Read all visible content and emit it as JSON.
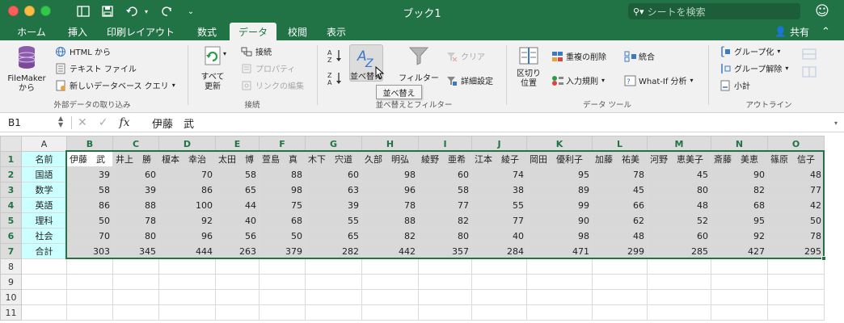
{
  "window": {
    "title": "ブック1",
    "search_placeholder": "シートを検索"
  },
  "tabs": [
    {
      "label": "ホーム"
    },
    {
      "label": "挿入"
    },
    {
      "label": "印刷レイアウト"
    },
    {
      "label": "数式"
    },
    {
      "label": "データ"
    },
    {
      "label": "校閲"
    },
    {
      "label": "表示"
    }
  ],
  "share_label": "共有",
  "ribbon": {
    "filemaker": "FileMaker\nから",
    "html_from": "HTML から",
    "text_file": "テキスト ファイル",
    "new_db_query": "新しいデータベース クエリ",
    "group_external": "外部データの取り込み",
    "refresh_all": "すべて\n更新",
    "connections": "接続",
    "properties": "プロパティ",
    "edit_links": "リンクの編集",
    "group_connections": "接続",
    "sort": "並べ替え",
    "filter": "フィルター",
    "clear": "クリア",
    "advanced": "詳細設定",
    "group_sort_filter": "並べ替えとフィルター",
    "text_to_columns": "区切り\n位置",
    "remove_duplicates": "重複の削除",
    "data_validation": "入力規則",
    "consolidate": "統合",
    "what_if": "What-If 分析",
    "group_data_tools": "データ ツール",
    "group": "グループ化",
    "ungroup": "グループ解除",
    "subtotal": "小計",
    "group_outline": "アウトライン",
    "tooltip": "並べ替え"
  },
  "formula_bar": {
    "name_box": "B1",
    "fx": "fx",
    "content": "伊藤　武"
  },
  "sheet": {
    "columns": [
      "A",
      "B",
      "C",
      "D",
      "E",
      "F",
      "G",
      "H",
      "I",
      "J",
      "K",
      "L",
      "M",
      "N",
      "O"
    ],
    "row_numbers": [
      "1",
      "2",
      "3",
      "4",
      "5",
      "6",
      "7",
      "8",
      "9",
      "10",
      "11"
    ],
    "header_row": [
      "名前",
      "伊藤　武",
      "井上　勝",
      "榎本　幸治",
      "太田　博",
      "萱島　真",
      "木下　宍道",
      "久部　明弘",
      "綾野　亜希",
      "江本　綾子",
      "岡田　優利子",
      "加藤　祐美",
      "河野　恵美子",
      "斎藤　美恵",
      "篠原　信子"
    ],
    "data_rows": [
      {
        "label": "国語",
        "values": [
          39,
          60,
          70,
          58,
          88,
          60,
          98,
          60,
          74,
          95,
          78,
          45,
          90,
          48
        ]
      },
      {
        "label": "数学",
        "values": [
          58,
          39,
          86,
          65,
          98,
          63,
          96,
          58,
          38,
          89,
          45,
          80,
          82,
          77
        ]
      },
      {
        "label": "英語",
        "values": [
          86,
          88,
          100,
          44,
          75,
          39,
          78,
          77,
          55,
          99,
          66,
          48,
          68,
          42
        ]
      },
      {
        "label": "理科",
        "values": [
          50,
          78,
          92,
          40,
          68,
          55,
          88,
          82,
          77,
          90,
          62,
          52,
          95,
          50
        ]
      },
      {
        "label": "社会",
        "values": [
          70,
          80,
          96,
          56,
          50,
          65,
          82,
          80,
          40,
          98,
          48,
          60,
          92,
          78
        ]
      },
      {
        "label": "合計",
        "values": [
          303,
          345,
          444,
          263,
          379,
          282,
          442,
          357,
          284,
          471,
          299,
          285,
          427,
          295
        ]
      }
    ]
  },
  "colors": {
    "accent": "#217346",
    "label_fill": "#ccffff",
    "selection_fill": "#d8d8d8"
  }
}
